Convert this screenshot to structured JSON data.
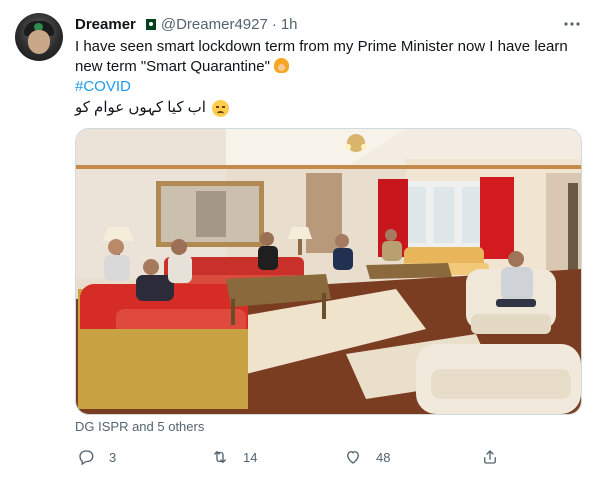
{
  "tweet": {
    "author_name": "Dreamer",
    "author_handle": "@Dreamer4927",
    "separator": "·",
    "time": "1h",
    "text_line1": "I have seen smart lockdown term from my Prime Minister now I have learn",
    "text_line2": "new term \"Smart Quarantine\"",
    "hashtag": "#COVID",
    "urdu_text": "اب کیا کہوں عوام کو",
    "liked_by": "DG ISPR and 5 others",
    "replies": "3",
    "retweets": "14",
    "likes": "48"
  },
  "icons": {
    "more": "more-options-icon",
    "reply": "reply-icon",
    "retweet": "retweet-icon",
    "like": "heart-icon",
    "share": "share-icon"
  },
  "colors": {
    "link": "#1d9bf0",
    "muted": "#536471",
    "text": "#0f1419"
  }
}
